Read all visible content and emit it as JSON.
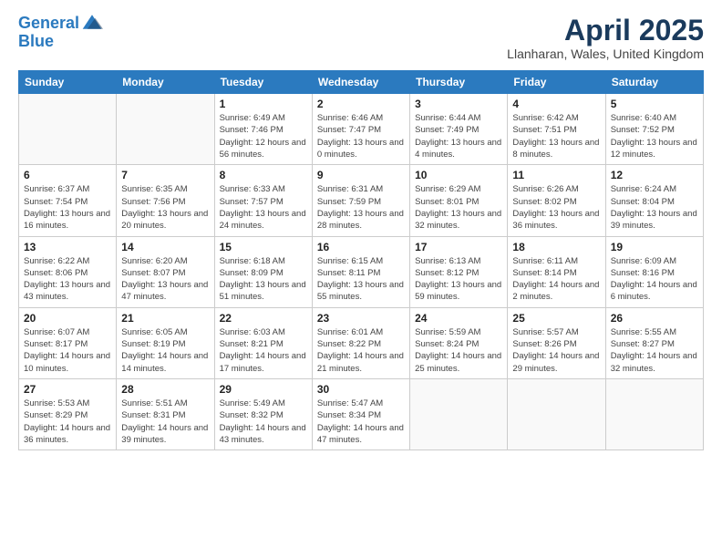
{
  "header": {
    "logo_line1": "General",
    "logo_line2": "Blue",
    "month_year": "April 2025",
    "location": "Llanharan, Wales, United Kingdom"
  },
  "weekdays": [
    "Sunday",
    "Monday",
    "Tuesday",
    "Wednesday",
    "Thursday",
    "Friday",
    "Saturday"
  ],
  "weeks": [
    [
      {
        "day": "",
        "info": ""
      },
      {
        "day": "",
        "info": ""
      },
      {
        "day": "1",
        "info": "Sunrise: 6:49 AM\nSunset: 7:46 PM\nDaylight: 12 hours and 56 minutes."
      },
      {
        "day": "2",
        "info": "Sunrise: 6:46 AM\nSunset: 7:47 PM\nDaylight: 13 hours and 0 minutes."
      },
      {
        "day": "3",
        "info": "Sunrise: 6:44 AM\nSunset: 7:49 PM\nDaylight: 13 hours and 4 minutes."
      },
      {
        "day": "4",
        "info": "Sunrise: 6:42 AM\nSunset: 7:51 PM\nDaylight: 13 hours and 8 minutes."
      },
      {
        "day": "5",
        "info": "Sunrise: 6:40 AM\nSunset: 7:52 PM\nDaylight: 13 hours and 12 minutes."
      }
    ],
    [
      {
        "day": "6",
        "info": "Sunrise: 6:37 AM\nSunset: 7:54 PM\nDaylight: 13 hours and 16 minutes."
      },
      {
        "day": "7",
        "info": "Sunrise: 6:35 AM\nSunset: 7:56 PM\nDaylight: 13 hours and 20 minutes."
      },
      {
        "day": "8",
        "info": "Sunrise: 6:33 AM\nSunset: 7:57 PM\nDaylight: 13 hours and 24 minutes."
      },
      {
        "day": "9",
        "info": "Sunrise: 6:31 AM\nSunset: 7:59 PM\nDaylight: 13 hours and 28 minutes."
      },
      {
        "day": "10",
        "info": "Sunrise: 6:29 AM\nSunset: 8:01 PM\nDaylight: 13 hours and 32 minutes."
      },
      {
        "day": "11",
        "info": "Sunrise: 6:26 AM\nSunset: 8:02 PM\nDaylight: 13 hours and 36 minutes."
      },
      {
        "day": "12",
        "info": "Sunrise: 6:24 AM\nSunset: 8:04 PM\nDaylight: 13 hours and 39 minutes."
      }
    ],
    [
      {
        "day": "13",
        "info": "Sunrise: 6:22 AM\nSunset: 8:06 PM\nDaylight: 13 hours and 43 minutes."
      },
      {
        "day": "14",
        "info": "Sunrise: 6:20 AM\nSunset: 8:07 PM\nDaylight: 13 hours and 47 minutes."
      },
      {
        "day": "15",
        "info": "Sunrise: 6:18 AM\nSunset: 8:09 PM\nDaylight: 13 hours and 51 minutes."
      },
      {
        "day": "16",
        "info": "Sunrise: 6:15 AM\nSunset: 8:11 PM\nDaylight: 13 hours and 55 minutes."
      },
      {
        "day": "17",
        "info": "Sunrise: 6:13 AM\nSunset: 8:12 PM\nDaylight: 13 hours and 59 minutes."
      },
      {
        "day": "18",
        "info": "Sunrise: 6:11 AM\nSunset: 8:14 PM\nDaylight: 14 hours and 2 minutes."
      },
      {
        "day": "19",
        "info": "Sunrise: 6:09 AM\nSunset: 8:16 PM\nDaylight: 14 hours and 6 minutes."
      }
    ],
    [
      {
        "day": "20",
        "info": "Sunrise: 6:07 AM\nSunset: 8:17 PM\nDaylight: 14 hours and 10 minutes."
      },
      {
        "day": "21",
        "info": "Sunrise: 6:05 AM\nSunset: 8:19 PM\nDaylight: 14 hours and 14 minutes."
      },
      {
        "day": "22",
        "info": "Sunrise: 6:03 AM\nSunset: 8:21 PM\nDaylight: 14 hours and 17 minutes."
      },
      {
        "day": "23",
        "info": "Sunrise: 6:01 AM\nSunset: 8:22 PM\nDaylight: 14 hours and 21 minutes."
      },
      {
        "day": "24",
        "info": "Sunrise: 5:59 AM\nSunset: 8:24 PM\nDaylight: 14 hours and 25 minutes."
      },
      {
        "day": "25",
        "info": "Sunrise: 5:57 AM\nSunset: 8:26 PM\nDaylight: 14 hours and 29 minutes."
      },
      {
        "day": "26",
        "info": "Sunrise: 5:55 AM\nSunset: 8:27 PM\nDaylight: 14 hours and 32 minutes."
      }
    ],
    [
      {
        "day": "27",
        "info": "Sunrise: 5:53 AM\nSunset: 8:29 PM\nDaylight: 14 hours and 36 minutes."
      },
      {
        "day": "28",
        "info": "Sunrise: 5:51 AM\nSunset: 8:31 PM\nDaylight: 14 hours and 39 minutes."
      },
      {
        "day": "29",
        "info": "Sunrise: 5:49 AM\nSunset: 8:32 PM\nDaylight: 14 hours and 43 minutes."
      },
      {
        "day": "30",
        "info": "Sunrise: 5:47 AM\nSunset: 8:34 PM\nDaylight: 14 hours and 47 minutes."
      },
      {
        "day": "",
        "info": ""
      },
      {
        "day": "",
        "info": ""
      },
      {
        "day": "",
        "info": ""
      }
    ]
  ]
}
